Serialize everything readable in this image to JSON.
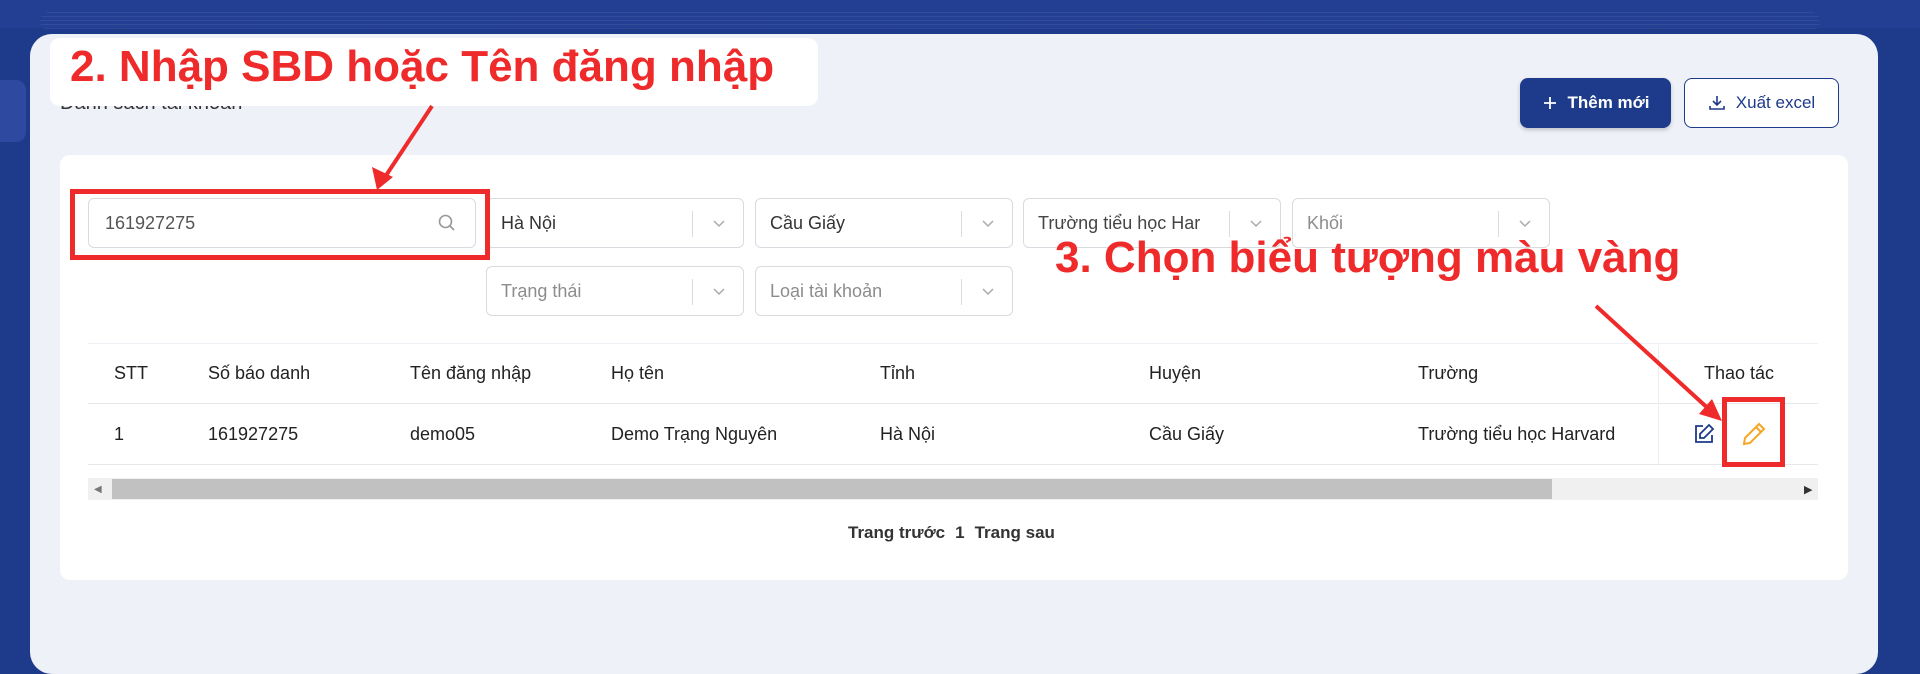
{
  "page": {
    "title": "Danh sách tài khoản"
  },
  "toolbar": {
    "add_label": "Thêm mới",
    "export_label": "Xuất excel"
  },
  "filters": {
    "search_value": "161927275",
    "province": "Hà Nội",
    "district": "Cầu Giấy",
    "school": "Trường tiểu học Har",
    "grade_placeholder": "Khối",
    "status_placeholder": "Trạng thái",
    "account_type_placeholder": "Loại tài khoản"
  },
  "table": {
    "headers": [
      "STT",
      "Số báo danh",
      "Tên đăng nhập",
      "Họ tên",
      "Tỉnh",
      "Huyện",
      "Trường",
      "Thao tác"
    ],
    "rows": [
      {
        "stt": "1",
        "sbd": "161927275",
        "username": "demo05",
        "fullname": "Demo Trạng Nguyên",
        "province": "Hà Nội",
        "district": "Cầu Giấy",
        "school": "Trường tiểu học Harvard"
      }
    ]
  },
  "pagination": {
    "prev": "Trang trước",
    "current": "1",
    "next": "Trang sau"
  },
  "annotations": {
    "step2": "2. Nhập SBD hoặc Tên đăng nhập",
    "step3": "3. Chọn biểu tượng màu vàng"
  },
  "colors": {
    "primary": "#1e3a8a",
    "highlight": "#ef2a2a",
    "pencil": "#f5a623",
    "panel": "#eef1f8"
  }
}
